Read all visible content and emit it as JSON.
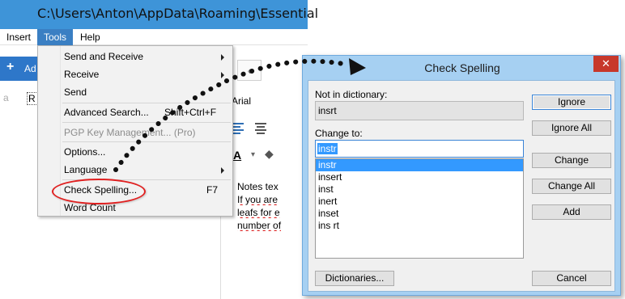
{
  "app": {
    "title": "C:\\Users\\Anton\\AppData\\Roaming\\Essential",
    "menu": [
      "Insert",
      "Tools",
      "Help"
    ],
    "toolbar_add": "Ad",
    "tree_stub": "a",
    "tree_item": "R",
    "nav_prev": "‹",
    "font_name": "Arial",
    "font_color_glyph": "A",
    "dropdown_glyph": "▾",
    "fill_glyph": "◆",
    "notes": [
      "Notes tex",
      "If you are",
      "leafs for e",
      "number of"
    ]
  },
  "tools_menu": {
    "items": [
      {
        "label": "Send and Receive",
        "submenu": true
      },
      {
        "label": "Receive",
        "submenu": true
      },
      {
        "label": "Send"
      },
      {
        "label": "Advanced Search...",
        "shortcut": "Shift+Ctrl+F"
      },
      {
        "label": "PGP Key Management... (Pro)",
        "disabled": true
      },
      {
        "label": "Options..."
      },
      {
        "label": "Language",
        "submenu": true
      },
      {
        "label": "Check Spelling...",
        "shortcut": "F7"
      },
      {
        "label": "Word Count"
      }
    ]
  },
  "dialog": {
    "title": "Check Spelling",
    "close_glyph": "✕",
    "not_in_dictionary_label": "Not in dictionary:",
    "not_in_dictionary_value": "insrt",
    "change_to_label": "Change to:",
    "change_to_value": "instr",
    "suggestions": [
      "instr",
      "insert",
      "inst",
      "inert",
      "inset",
      "ins rt"
    ],
    "selected_suggestion": "instr",
    "buttons": {
      "ignore": "Ignore",
      "ignore_all": "Ignore All",
      "change": "Change",
      "change_all": "Change All",
      "add": "Add",
      "dictionaries": "Dictionaries...",
      "cancel": "Cancel"
    }
  },
  "colors": {
    "titlebar": "#3e94d8",
    "menu_active": "#3a7fc3",
    "dialog_frame": "#a6d0f2",
    "close_button": "#c7382b",
    "selection": "#3399ff",
    "highlight_ring": "#e02020"
  }
}
